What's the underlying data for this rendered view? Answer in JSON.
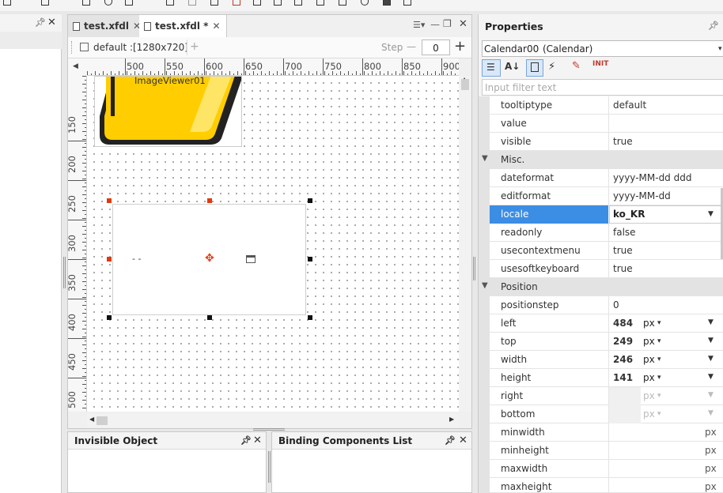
{
  "tabs": [
    {
      "label": "test.xfdl",
      "close": "✕"
    },
    {
      "label": "test.xfdl *",
      "close": "✕"
    }
  ],
  "toolbar": {
    "layout_label": "default :",
    "layout_size": "[1280x720]",
    "add": "+",
    "step_label": "Step",
    "step_minus": "—",
    "step_value": "0",
    "step_plus": "+"
  },
  "ruler_h": [
    "500",
    "550",
    "600",
    "650",
    "700",
    "750",
    "800",
    "850",
    "900"
  ],
  "ruler_v": [
    "150",
    "200",
    "250",
    "300",
    "350",
    "400",
    "450",
    "500"
  ],
  "canvas": {
    "imageviewer_label": "ImageViewer01",
    "calendar_value": "- -"
  },
  "bottom_panels": {
    "invisible_object": "Invisible Object",
    "binding_list": "Binding Components List"
  },
  "properties": {
    "title": "Properties",
    "component": "Calendar00",
    "component_type": "(Calendar)",
    "filter_placeholder": "Input filter text",
    "rows_top": [
      {
        "name": "tooltiptype",
        "value": "default"
      },
      {
        "name": "value",
        "value": ""
      },
      {
        "name": "visible",
        "value": "true"
      }
    ],
    "group_misc": "Misc.",
    "rows_misc": [
      {
        "name": "dateformat",
        "value": "yyyy-MM-dd ddd"
      },
      {
        "name": "editformat",
        "value": "yyyy-MM-dd"
      },
      {
        "name": "locale",
        "value": "ko_KR"
      },
      {
        "name": "readonly",
        "value": "false"
      },
      {
        "name": "usecontextmenu",
        "value": "true"
      },
      {
        "name": "usesoftkeyboard",
        "value": "true"
      }
    ],
    "group_position": "Position",
    "rows_position": [
      {
        "name": "positionstep",
        "value": "0",
        "unit": ""
      },
      {
        "name": "left",
        "value": "484",
        "unit": "px"
      },
      {
        "name": "top",
        "value": "249",
        "unit": "px"
      },
      {
        "name": "width",
        "value": "246",
        "unit": "px"
      },
      {
        "name": "height",
        "value": "141",
        "unit": "px"
      },
      {
        "name": "right",
        "value": "",
        "unit": "px"
      },
      {
        "name": "bottom",
        "value": "",
        "unit": "px"
      },
      {
        "name": "minwidth",
        "value": "",
        "unit": "px"
      },
      {
        "name": "minheight",
        "value": "",
        "unit": "px"
      },
      {
        "name": "maxwidth",
        "value": "",
        "unit": "px"
      },
      {
        "name": "maxheight",
        "value": "",
        "unit": "px"
      }
    ]
  },
  "colors": {
    "selected_row": "#3c8de4",
    "handle_red": "#e03a10",
    "handle_black": "#111111",
    "yellow": "#ffcd00"
  }
}
